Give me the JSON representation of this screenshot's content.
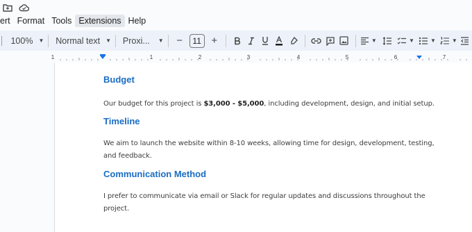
{
  "menu": {
    "items": [
      {
        "label": "ert"
      },
      {
        "label": "Format"
      },
      {
        "label": "Tools"
      },
      {
        "label": "Extensions"
      },
      {
        "label": "Help"
      }
    ]
  },
  "toolbar": {
    "zoom": "100%",
    "style": "Normal text",
    "font": "Proxi...",
    "minus": "−",
    "font_size": "11",
    "plus": "+"
  },
  "ruler": {
    "numbers": [
      "1",
      "1",
      "2",
      "3",
      "4",
      "5",
      "6",
      "7"
    ]
  },
  "document": {
    "sections": [
      {
        "heading": "Budget",
        "text_before": "Our budget for this project is ",
        "text_bold": "$3,000 - $5,000",
        "text_after": ", including development, design, and initial setup."
      },
      {
        "heading": "Timeline",
        "line1": "We aim to launch the website within 8-10 weeks, allowing time for design, development, testing,",
        "line2": "and feedback."
      },
      {
        "heading": "Communication Method",
        "line1": "I prefer to communicate via email or Slack for regular updates and discussions throughout the",
        "line2": "project."
      }
    ]
  },
  "colors": {
    "heading": "#1a6dc4",
    "toolbar_bg": "#edf2fa",
    "ruler_marker": "#1a73e8"
  }
}
